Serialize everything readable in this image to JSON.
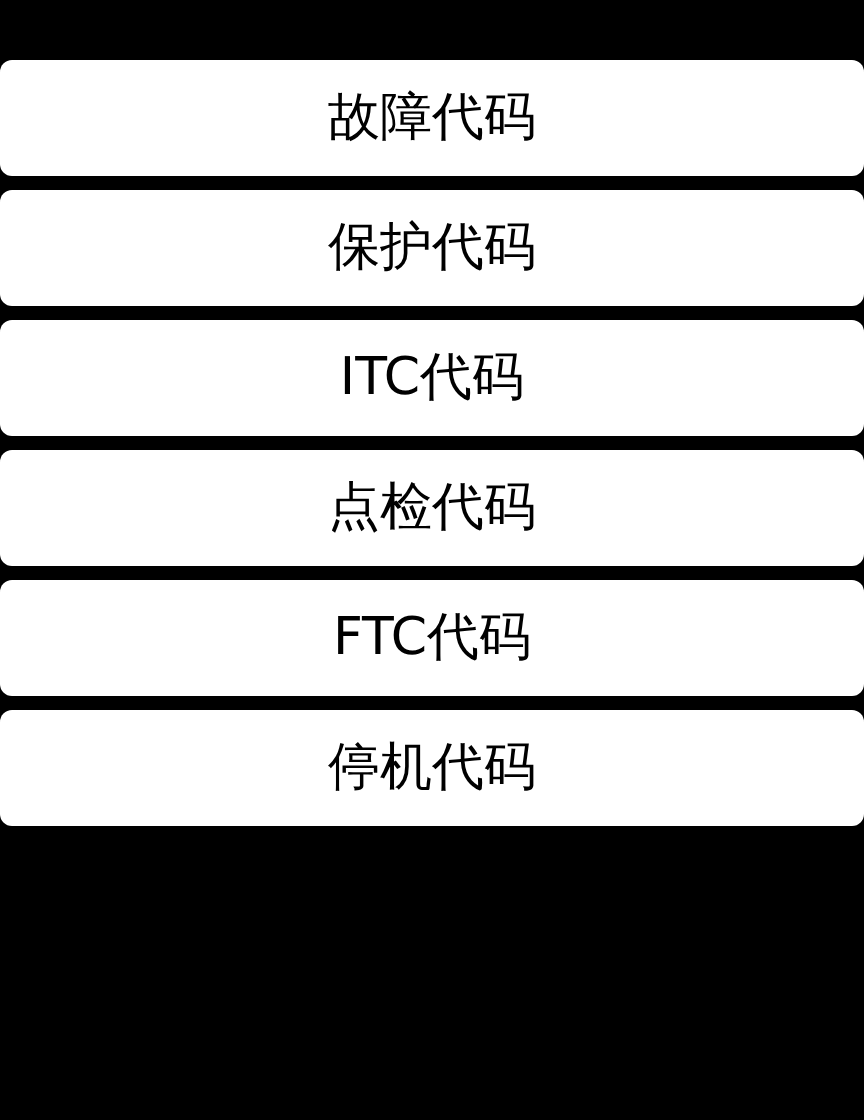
{
  "menu": [
    {
      "label": "故障代码"
    },
    {
      "label": "保护代码"
    },
    {
      "label": "ITC代码"
    },
    {
      "label": "点检代码"
    },
    {
      "label": "FTC代码"
    },
    {
      "label": "停机代码"
    }
  ]
}
